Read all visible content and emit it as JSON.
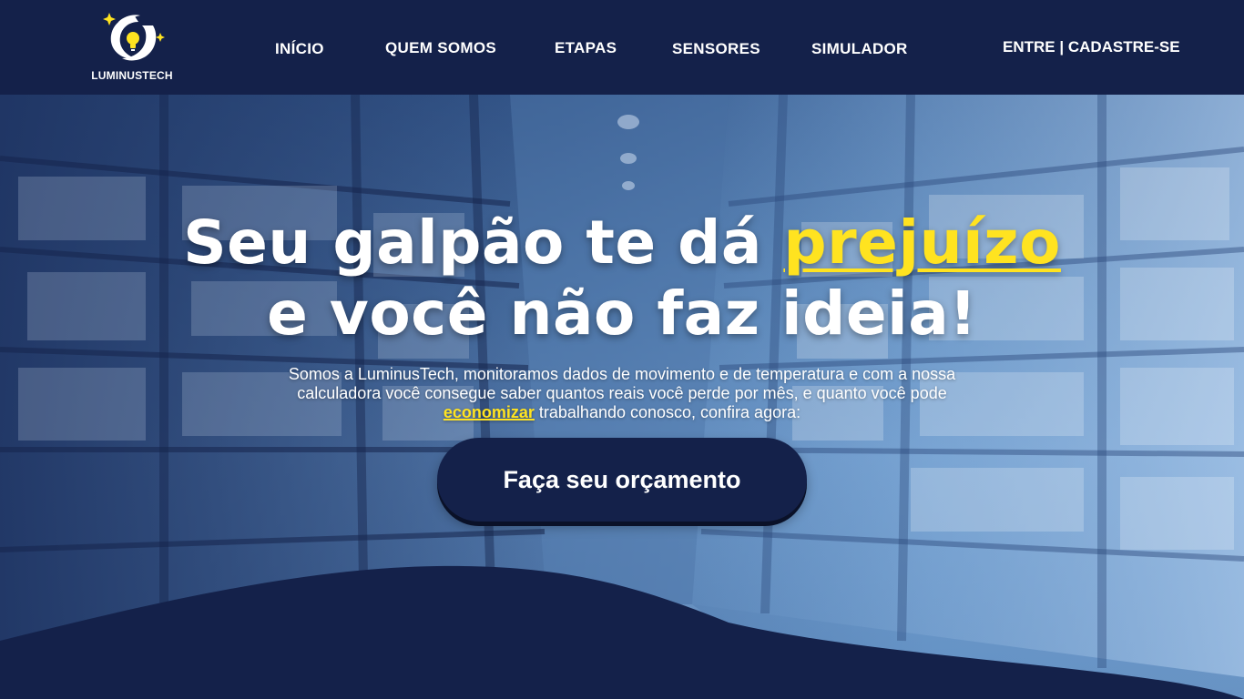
{
  "brand": {
    "name": "LUMINUSTECH"
  },
  "nav": {
    "items": [
      {
        "label": "INÍCIO"
      },
      {
        "label": "QUEM SOMOS"
      },
      {
        "label": "ETAPAS"
      },
      {
        "label": "SENSORES"
      },
      {
        "label": "SIMULADOR"
      }
    ],
    "auth_label": "ENTRE | CADASTRE-SE"
  },
  "hero": {
    "headline_line1_prefix": "Seu galpão te dá ",
    "headline_line1_highlight": "prejuízo",
    "headline_line2": "e você não faz ideia!",
    "lead_part1": "Somos a LuminusTech, monitoramos dados de movimento e de temperatura e com a nossa calculadora você consegue saber quantos reais você perde por mês, e quanto você pode ",
    "lead_highlight": "economizar",
    "lead_part2": " trabalhando conosco, confira agora:",
    "cta_label": "Faça seu orçamento"
  },
  "colors": {
    "navy": "#14214a",
    "accent_yellow": "#ffe320",
    "text": "#ffffff"
  },
  "icons": [
    "luminustech-logo-icon",
    "lightbulb-icon",
    "sparkle-icon"
  ]
}
